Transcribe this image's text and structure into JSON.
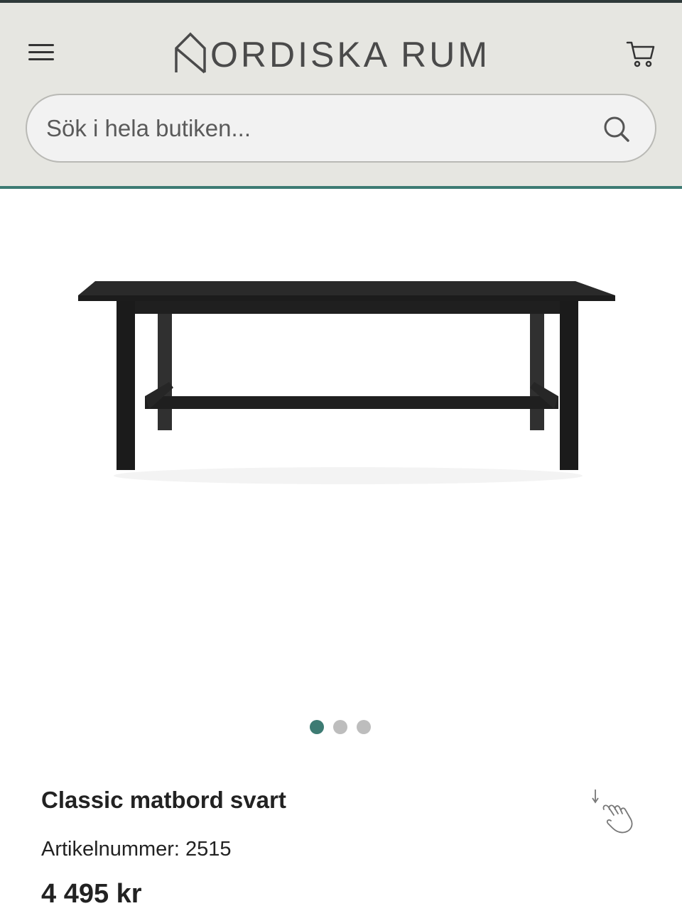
{
  "header": {
    "brand": "NORDISKA RUM",
    "brand_rest": "ORDISKA RUM",
    "menu_icon": "hamburger-menu-icon",
    "cart_icon": "shopping-cart-icon"
  },
  "search": {
    "placeholder": "Sök i hela butiken...",
    "value": "",
    "icon": "search-icon"
  },
  "gallery": {
    "image_count": 3,
    "active_index": 0
  },
  "product": {
    "name": "Classic matbord svart",
    "sku_label": "Artikelnummer:",
    "sku_value": "2515",
    "price": "4 495 kr"
  },
  "colors": {
    "header_bg": "#e6e6e1",
    "accent": "#3d7b73",
    "dot_inactive": "#bdbdbd"
  }
}
